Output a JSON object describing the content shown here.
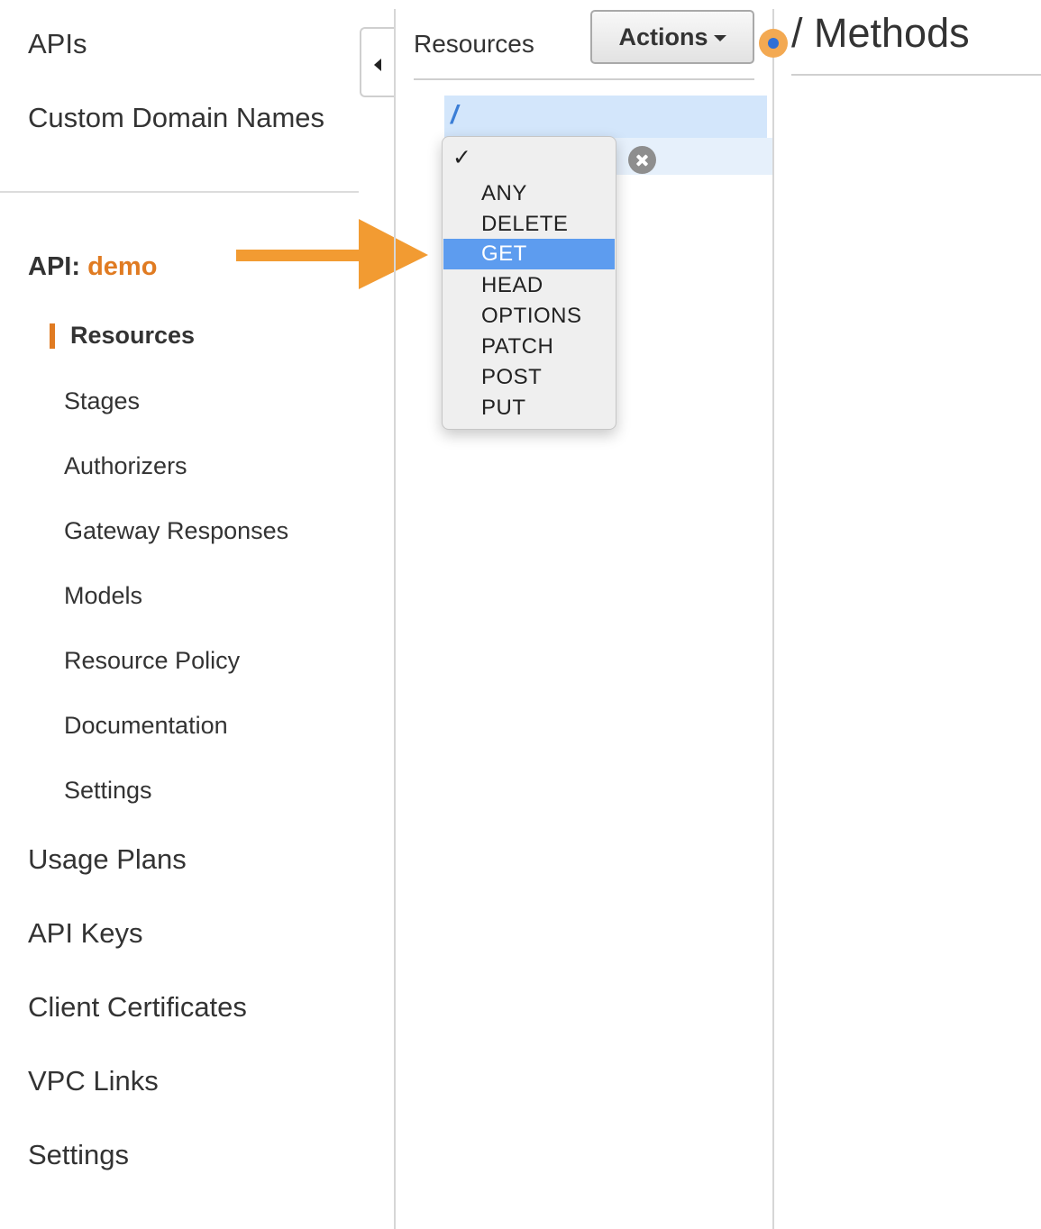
{
  "sidebar": {
    "top_items": [
      {
        "label": "APIs"
      },
      {
        "label": "Custom Domain Names"
      }
    ],
    "api_heading": {
      "prefix": "API:",
      "name": "demo"
    },
    "api_items": [
      {
        "label": "Resources",
        "active": true
      },
      {
        "label": "Stages"
      },
      {
        "label": "Authorizers"
      },
      {
        "label": "Gateway Responses"
      },
      {
        "label": "Models"
      },
      {
        "label": "Resource Policy"
      },
      {
        "label": "Documentation"
      },
      {
        "label": "Settings"
      }
    ],
    "bottom_items": [
      {
        "label": "Usage Plans"
      },
      {
        "label": "API Keys"
      },
      {
        "label": "Client Certificates"
      },
      {
        "label": "VPC Links"
      },
      {
        "label": "Settings"
      }
    ]
  },
  "resources": {
    "title": "Resources",
    "actions_label": "Actions",
    "root_path": "/"
  },
  "method_menu": {
    "check_glyph": "✓",
    "options": [
      "ANY",
      "DELETE",
      "GET",
      "HEAD",
      "OPTIONS",
      "PATCH",
      "POST",
      "PUT"
    ],
    "highlighted": "GET"
  },
  "methods_panel": {
    "title": "/ Methods"
  },
  "colors": {
    "accent_orange": "#e07b22",
    "arrow_orange": "#f29b32",
    "menu_highlight": "#5d9cef",
    "tree_selected": "#d3e6fb"
  },
  "icons": [
    "collapse-left-icon",
    "caret-down-icon",
    "cancel-icon",
    "checkmark-icon",
    "annotation-arrow-icon",
    "step-indicator-icon"
  ]
}
